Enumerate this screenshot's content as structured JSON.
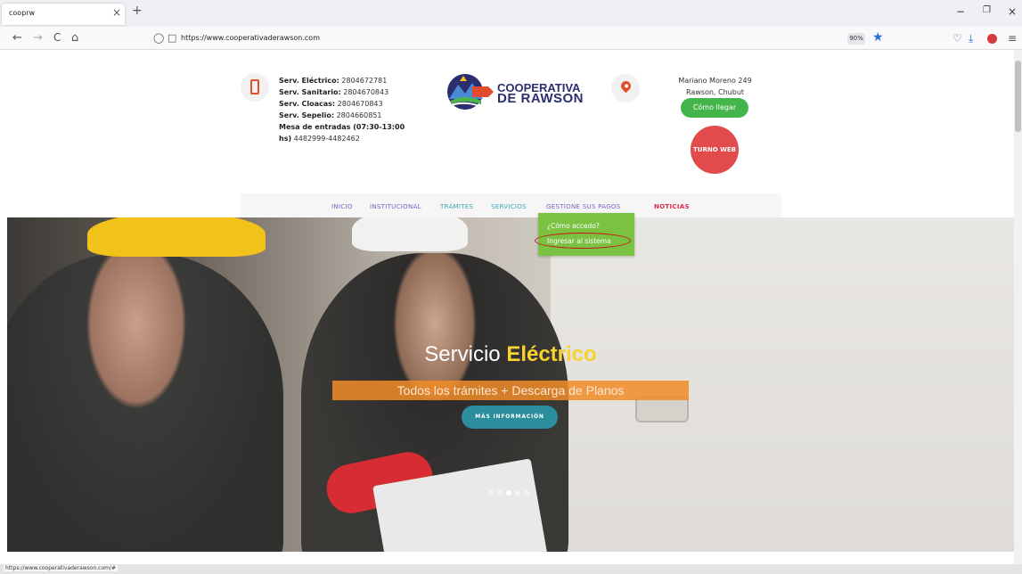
{
  "browser": {
    "tab_title": "cooprw",
    "tab_close": "×",
    "new_tab": "+",
    "url": "https://www.cooperativaderawson.com",
    "zoom": "90%",
    "minimize": "−",
    "restore": "❐",
    "close": "×",
    "back": "←",
    "forward": "→",
    "reload": "C",
    "home": "⌂"
  },
  "header": {
    "contact": [
      {
        "label": "Serv. Eléctrico:",
        "value": " 2804672781"
      },
      {
        "label": "Serv. Sanitario:",
        "value": " 2804670843"
      },
      {
        "label": "Serv. Cloacas:",
        "value": " 2804670843"
      },
      {
        "label": "Serv. Sepelio:",
        "value": " 2804660851"
      },
      {
        "label": "Mesa de entradas (07:30-13:00",
        "value": ""
      },
      {
        "label": "hs)",
        "value": " 4482999-4482462"
      }
    ],
    "logo_line1": "COOPERATIVA",
    "logo_line2": "DE RAWSON",
    "address_line1": "Mariano Moreno 249",
    "address_line2": "Rawson, Chubut",
    "how_to_get": "Cómo llegar",
    "turno_web": "TURNO WEB"
  },
  "menu": {
    "items": [
      {
        "label": "INICIO",
        "color": "#7b5fc7"
      },
      {
        "label": "INSTITUCIONAL",
        "color": "#7b5fc7"
      },
      {
        "label": "TRÁMITES",
        "color": "#3aa7b8"
      },
      {
        "label": "SERVICIOS",
        "color": "#3aa7b8"
      },
      {
        "label": "GESTIONE SUS PAGOS",
        "color": "#7b5fc7"
      },
      {
        "label": "NOTICIAS",
        "color": "#e02b4f"
      }
    ],
    "dropdown": [
      {
        "label": "¿Cómo accedo?"
      },
      {
        "label": "Ingresar al sistema"
      }
    ]
  },
  "hero": {
    "title_plain": "Servicio ",
    "title_accent": "Eléctrico",
    "subtitle": "Todos los trámites + Descarga de Planos",
    "button": "MÁS INFORMACIÓN"
  },
  "status": {
    "link": "https://www.cooperativaderawson.com/#"
  },
  "colors": {
    "green": "#44b54a",
    "dropdown_green": "#7cc242",
    "turno_red": "#e24b4b",
    "hero_button": "#2b8e9c",
    "accent_yellow": "#f7d230"
  }
}
